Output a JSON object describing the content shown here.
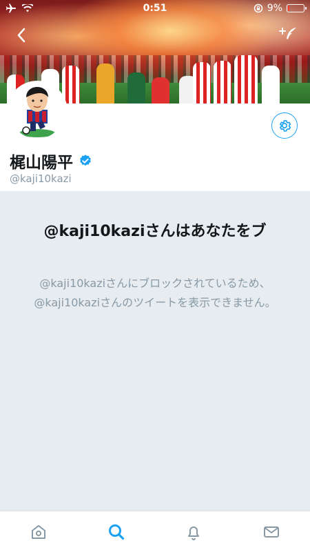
{
  "status": {
    "time": "0:51",
    "battery_percent": "9%",
    "battery_level": 0.09,
    "icons": [
      "airplane-icon",
      "wifi-icon",
      "rotation-lock-icon",
      "battery-icon"
    ]
  },
  "header": {
    "back_icon": "chevron-left-icon",
    "compose_icon": "compose-tweet-icon"
  },
  "profile": {
    "display_name": "梶山陽平",
    "handle": "@kaji10kazi",
    "verified": true,
    "settings_icon": "gear-icon"
  },
  "block_notice": {
    "title": "@kaji10kaziさんはあなたをブ",
    "description": "@kaji10kaziさんにブロックされているため、@kaji10kaziさんのツイートを表示できません。"
  },
  "tabbar": {
    "items": [
      {
        "icon": "home-icon",
        "active": false
      },
      {
        "icon": "search-icon",
        "active": true
      },
      {
        "icon": "notifications-icon",
        "active": false
      },
      {
        "icon": "messages-icon",
        "active": false
      }
    ]
  },
  "colors": {
    "accent": "#1da1f2",
    "muted": "#8899a6",
    "panel_bg": "#e6ecf0"
  }
}
